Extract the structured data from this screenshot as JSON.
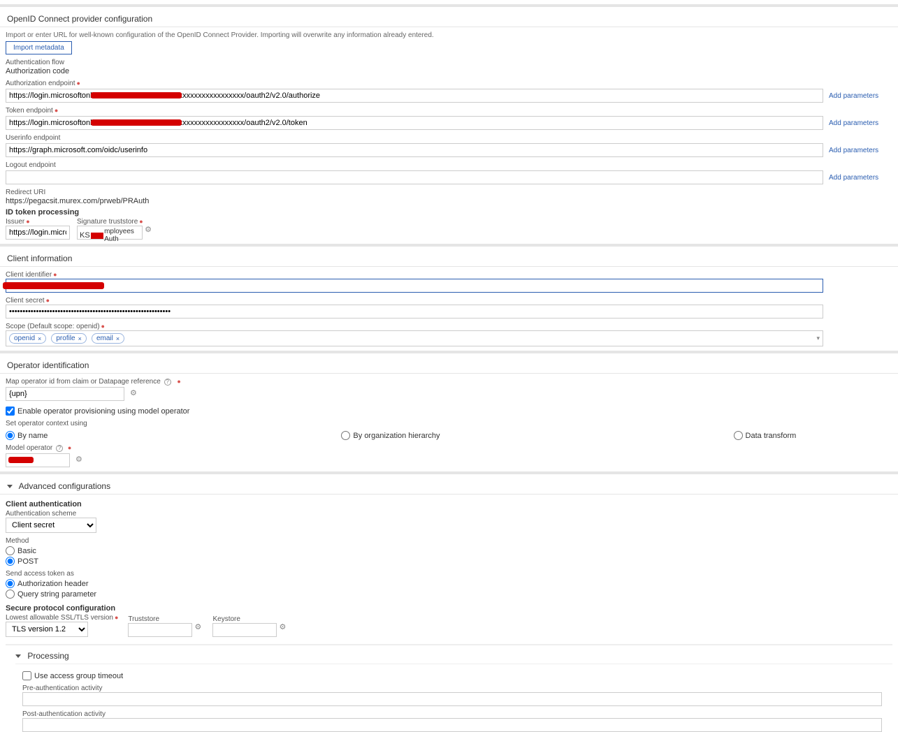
{
  "oidc": {
    "header": "OpenID Connect provider configuration",
    "hint": "Import or enter URL for well-known configuration of the OpenID Connect Provider. Importing will overwrite any information already entered.",
    "import_btn": "Import metadata",
    "auth_flow_label": "Authentication flow",
    "auth_flow_value": "Authorization code",
    "auth_endpoint_label": "Authorization endpoint",
    "auth_endpoint_value": "https://login.microsoftonline.com/xxxxxxxxxxxxxxxxxxxxxxxxxxxxxxxx/oauth2/v2.0/authorize",
    "token_endpoint_label": "Token endpoint",
    "token_endpoint_value": "https://login.microsoftonline.com/xxxxxxxxxxxxxxxxxxxxxxxxxxxxxxxx/oauth2/v2.0/token",
    "userinfo_endpoint_label": "Userinfo endpoint",
    "userinfo_endpoint_value": "https://graph.microsoft.com/oidc/userinfo",
    "logout_endpoint_label": "Logout endpoint",
    "logout_endpoint_value": "",
    "add_params": "Add parameters",
    "redirect_uri_label": "Redirect URI",
    "redirect_uri_value": "https://pegacsit.murex.com/prweb/PRAuth",
    "id_token_header": "ID token processing",
    "issuer_label": "Issuer",
    "issuer_value": "https://login.microsoftonlin",
    "sig_truststore_label": "Signature truststore",
    "sig_truststore_prefix": "KS",
    "sig_truststore_suffix": "mployees Auth"
  },
  "client": {
    "header": "Client information",
    "client_id_label": "Client identifier",
    "client_secret_label": "Client secret",
    "client_secret_value": "••••••••••••••••••••••••••••••••••••••••••••••••••••••••••••",
    "scope_label": "Scope (Default scope: openid)",
    "scopes": [
      "openid",
      "profile",
      "email"
    ]
  },
  "operator": {
    "header": "Operator identification",
    "map_label": "Map operator id from claim or Datapage reference",
    "map_value": "{upn}",
    "enable_provisioning": "Enable operator provisioning using model operator",
    "context_label": "Set operator context using",
    "context_options": {
      "by_name": "By name",
      "by_org": "By organization hierarchy",
      "by_dt": "Data transform"
    },
    "model_op_label": "Model operator"
  },
  "advanced": {
    "header": "Advanced configurations",
    "client_auth_header": "Client authentication",
    "auth_scheme_label": "Authentication scheme",
    "auth_scheme_value": "Client secret",
    "method_label": "Method",
    "method_options": {
      "basic": "Basic",
      "post": "POST"
    },
    "send_token_label": "Send access token as",
    "send_token_options": {
      "header": "Authorization header",
      "query": "Query string parameter"
    },
    "secure_proto_header": "Secure protocol configuration",
    "tls_label": "Lowest allowable SSL/TLS version",
    "tls_value": "TLS version 1.2",
    "truststore_label": "Truststore",
    "keystore_label": "Keystore"
  },
  "processing": {
    "header": "Processing",
    "use_ag_timeout": "Use access group timeout",
    "pre_auth_label": "Pre-authentication activity",
    "post_auth_label": "Post-authentication activity"
  }
}
